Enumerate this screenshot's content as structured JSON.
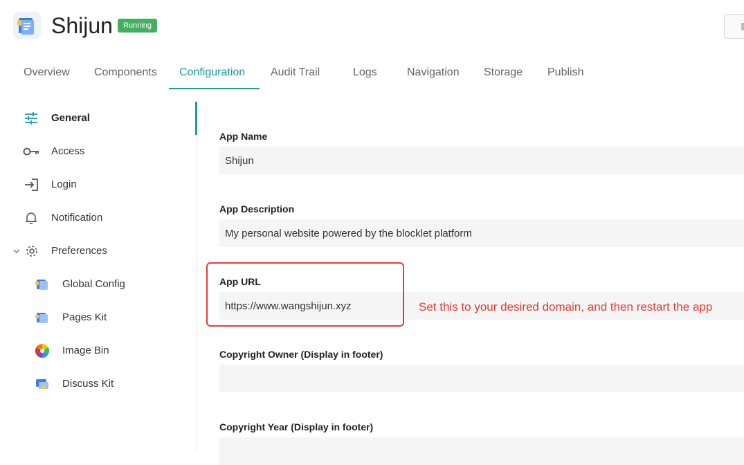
{
  "header": {
    "app_name": "Shijun",
    "status": "Running",
    "accent_color": "#1a9ba1",
    "status_color": "#44b05f"
  },
  "tabs": [
    {
      "label": "Overview",
      "active": false
    },
    {
      "label": "Components",
      "active": false
    },
    {
      "label": "Configuration",
      "active": true
    },
    {
      "label": "Audit Trail",
      "active": false
    },
    {
      "label": "Logs",
      "active": false
    },
    {
      "label": "Navigation",
      "active": false
    },
    {
      "label": "Storage",
      "active": false
    },
    {
      "label": "Publish",
      "active": false
    }
  ],
  "sidebar": {
    "items": [
      {
        "label": "General",
        "icon": "sliders-icon",
        "active": true
      },
      {
        "label": "Access",
        "icon": "key-icon"
      },
      {
        "label": "Login",
        "icon": "login-icon"
      },
      {
        "label": "Notification",
        "icon": "bell-icon"
      },
      {
        "label": "Preferences",
        "icon": "gear-icon",
        "expanded": true
      }
    ],
    "sub_items": [
      {
        "label": "Global Config",
        "icon": "blocklet-icon"
      },
      {
        "label": "Pages Kit",
        "icon": "blocklet-icon"
      },
      {
        "label": "Image Bin",
        "icon": "color-wheel-icon"
      },
      {
        "label": "Discuss Kit",
        "icon": "chat-icon"
      }
    ]
  },
  "form": {
    "app_name": {
      "label": "App Name",
      "value": "Shijun"
    },
    "app_description": {
      "label": "App Description",
      "value": "My personal website powered by the blocklet platform"
    },
    "app_url": {
      "label": "App URL",
      "value": "https://www.wangshijun.xyz"
    },
    "copyright_owner": {
      "label": "Copyright Owner (Display in footer)",
      "value": ""
    },
    "copyright_year": {
      "label": "Copyright Year (Display in footer)",
      "value": ""
    }
  },
  "annotation": {
    "text": "Set this to your desired domain, and then restart the app",
    "color": "#e33c32"
  }
}
